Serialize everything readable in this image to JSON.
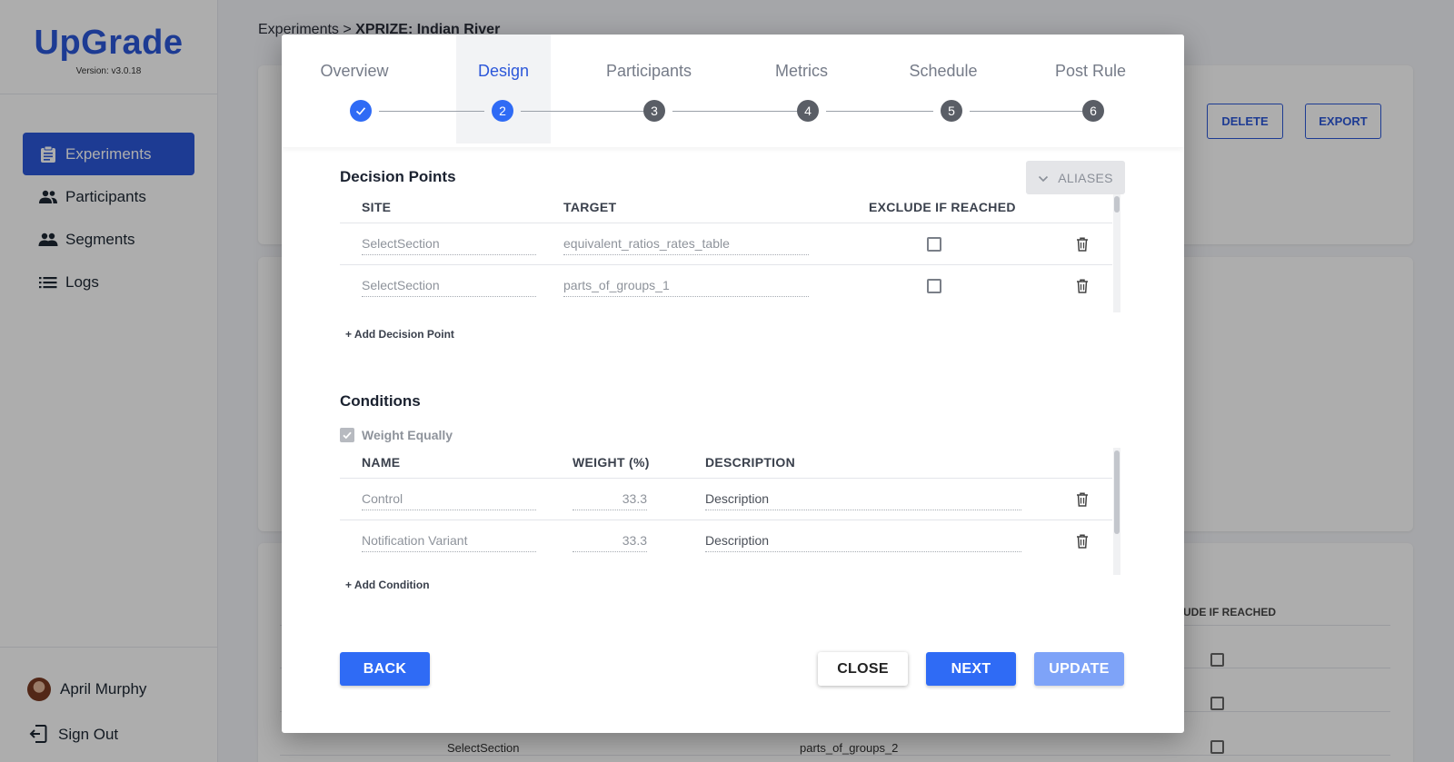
{
  "app": {
    "name": "UpGrade",
    "version": "Version: v3.0.18"
  },
  "sidebar": {
    "items": [
      {
        "label": "Experiments",
        "icon": "clipboard-icon",
        "active": true
      },
      {
        "label": "Participants",
        "icon": "participants-icon",
        "active": false
      },
      {
        "label": "Segments",
        "icon": "segments-icon",
        "active": false
      },
      {
        "label": "Logs",
        "icon": "list-icon",
        "active": false
      }
    ],
    "user": "April Murphy",
    "signout": "Sign Out"
  },
  "breadcrumb": {
    "parent": "Experiments",
    "separator": " > ",
    "current": "XPRIZE: Indian River"
  },
  "background": {
    "delete_label": "DELETE",
    "export_label": "EXPORT",
    "exclude_header": "UDE IF REACHED",
    "rows": [
      {
        "site": "SelectSection",
        "target": "parts_of_groups_2"
      }
    ]
  },
  "modal": {
    "steps": [
      {
        "label": "Overview",
        "marker": "check"
      },
      {
        "label": "Design",
        "marker": "2"
      },
      {
        "label": "Participants",
        "marker": "3"
      },
      {
        "label": "Metrics",
        "marker": "4"
      },
      {
        "label": "Schedule",
        "marker": "5"
      },
      {
        "label": "Post Rule",
        "marker": "6"
      }
    ],
    "decision_points": {
      "title": "Decision Points",
      "aliases_label": "ALIASES",
      "headers": {
        "site": "SITE",
        "target": "TARGET",
        "exclude": "EXCLUDE IF REACHED"
      },
      "rows": [
        {
          "site": "SelectSection",
          "target": "equivalent_ratios_rates_table"
        },
        {
          "site": "SelectSection",
          "target": "parts_of_groups_1"
        }
      ],
      "add_label": "+ Add Decision Point"
    },
    "conditions": {
      "title": "Conditions",
      "weight_equally": "Weight Equally",
      "headers": {
        "name": "NAME",
        "weight": "WEIGHT (%)",
        "description": "DESCRIPTION"
      },
      "rows": [
        {
          "name": "Control",
          "weight": "33.3",
          "description": "Description"
        },
        {
          "name": "Notification Variant",
          "weight": "33.3",
          "description": "Description"
        }
      ],
      "add_label": "+ Add Condition"
    },
    "buttons": {
      "back": "BACK",
      "close": "CLOSE",
      "next": "NEXT",
      "update": "UPDATE"
    }
  },
  "colors": {
    "brand": "#2c57d9",
    "primary": "#2f6bf5",
    "disabled": "#7ea3f8"
  }
}
